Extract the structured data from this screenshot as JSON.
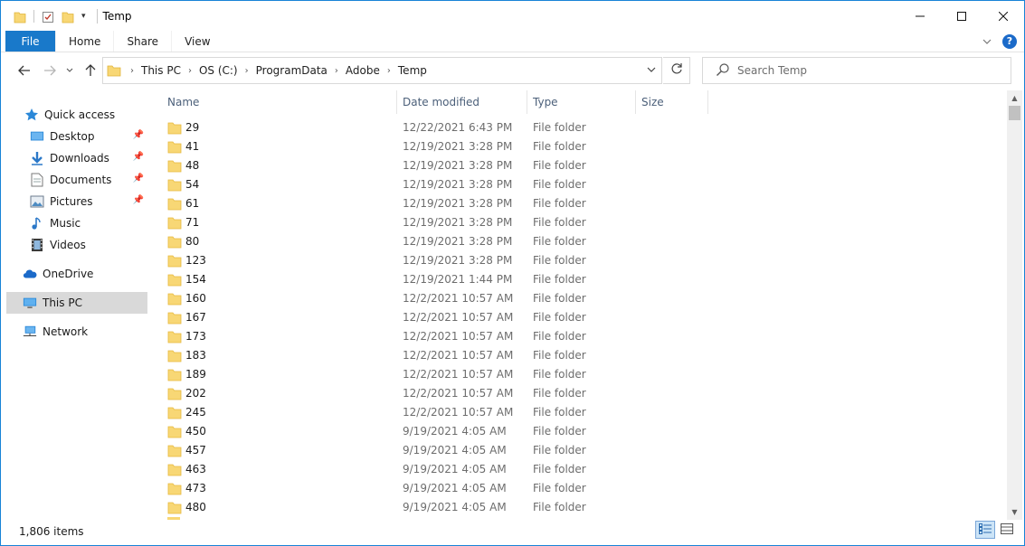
{
  "window": {
    "title": "Temp",
    "controls": {
      "minimize": "—",
      "maximize": "☐",
      "close": "✕"
    }
  },
  "ribbon": {
    "tabs": [
      {
        "label": "File"
      },
      {
        "label": "Home"
      },
      {
        "label": "Share"
      },
      {
        "label": "View"
      }
    ]
  },
  "address": {
    "crumbs": [
      "This PC",
      "OS (C:)",
      "ProgramData",
      "Adobe",
      "Temp"
    ]
  },
  "search": {
    "placeholder": "Search Temp"
  },
  "navpane": {
    "items": [
      {
        "label": "Quick access",
        "icon": "star-icon",
        "pinned": false
      },
      {
        "label": "Desktop",
        "icon": "desktop-icon",
        "pinned": true
      },
      {
        "label": "Downloads",
        "icon": "download-icon",
        "pinned": true
      },
      {
        "label": "Documents",
        "icon": "documents-icon",
        "pinned": true
      },
      {
        "label": "Pictures",
        "icon": "pictures-icon",
        "pinned": true
      },
      {
        "label": "Music",
        "icon": "music-icon",
        "pinned": false
      },
      {
        "label": "Videos",
        "icon": "videos-icon",
        "pinned": false
      },
      {
        "label": "OneDrive",
        "icon": "cloud-icon",
        "pinned": false
      },
      {
        "label": "This PC",
        "icon": "computer-icon",
        "pinned": false,
        "selected": true
      },
      {
        "label": "Network",
        "icon": "network-icon",
        "pinned": false
      }
    ]
  },
  "columns": {
    "name": "Name",
    "date": "Date modified",
    "type": "Type",
    "size": "Size"
  },
  "files": [
    {
      "name": "29",
      "date": "12/22/2021 6:43 PM",
      "type": "File folder"
    },
    {
      "name": "41",
      "date": "12/19/2021 3:28 PM",
      "type": "File folder"
    },
    {
      "name": "48",
      "date": "12/19/2021 3:28 PM",
      "type": "File folder"
    },
    {
      "name": "54",
      "date": "12/19/2021 3:28 PM",
      "type": "File folder"
    },
    {
      "name": "61",
      "date": "12/19/2021 3:28 PM",
      "type": "File folder"
    },
    {
      "name": "71",
      "date": "12/19/2021 3:28 PM",
      "type": "File folder"
    },
    {
      "name": "80",
      "date": "12/19/2021 3:28 PM",
      "type": "File folder"
    },
    {
      "name": "123",
      "date": "12/19/2021 3:28 PM",
      "type": "File folder"
    },
    {
      "name": "154",
      "date": "12/19/2021 1:44 PM",
      "type": "File folder"
    },
    {
      "name": "160",
      "date": "12/2/2021 10:57 AM",
      "type": "File folder"
    },
    {
      "name": "167",
      "date": "12/2/2021 10:57 AM",
      "type": "File folder"
    },
    {
      "name": "173",
      "date": "12/2/2021 10:57 AM",
      "type": "File folder"
    },
    {
      "name": "183",
      "date": "12/2/2021 10:57 AM",
      "type": "File folder"
    },
    {
      "name": "189",
      "date": "12/2/2021 10:57 AM",
      "type": "File folder"
    },
    {
      "name": "202",
      "date": "12/2/2021 10:57 AM",
      "type": "File folder"
    },
    {
      "name": "245",
      "date": "12/2/2021 10:57 AM",
      "type": "File folder"
    },
    {
      "name": "450",
      "date": "9/19/2021 4:05 AM",
      "type": "File folder"
    },
    {
      "name": "457",
      "date": "9/19/2021 4:05 AM",
      "type": "File folder"
    },
    {
      "name": "463",
      "date": "9/19/2021 4:05 AM",
      "type": "File folder"
    },
    {
      "name": "473",
      "date": "9/19/2021 4:05 AM",
      "type": "File folder"
    },
    {
      "name": "480",
      "date": "9/19/2021 4:05 AM",
      "type": "File folder"
    }
  ],
  "status": {
    "item_count": "1,806 items"
  },
  "colors": {
    "accent": "#1979ca",
    "folder": "#f8d775",
    "folder_dark": "#e6b93c"
  }
}
